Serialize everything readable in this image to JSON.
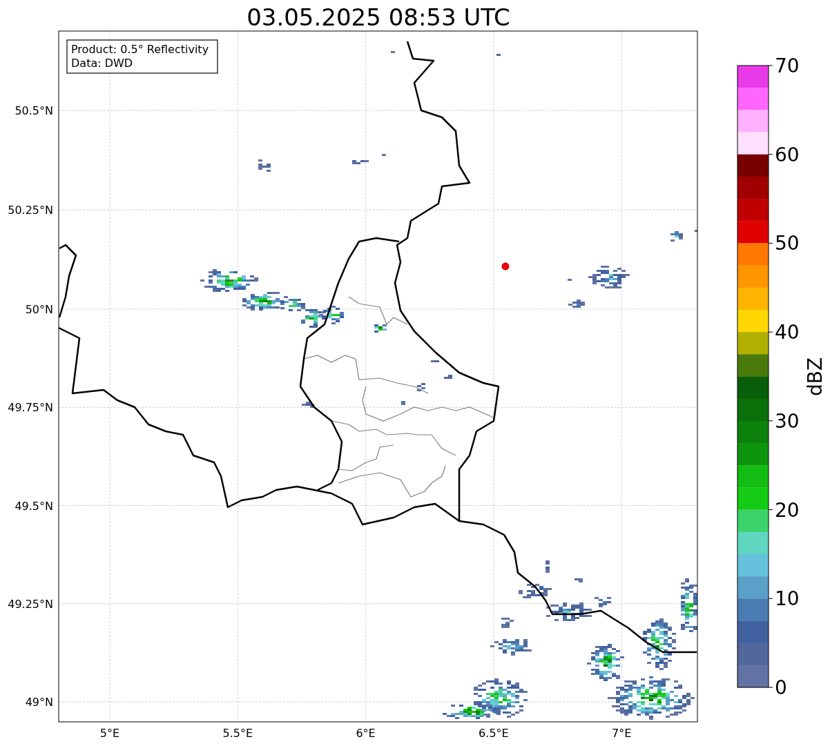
{
  "title": "03.05.2025 08:53 UTC",
  "map": {
    "info_box": [
      "Product: 0.5° Reflectivity",
      "Data: DWD"
    ],
    "lat_ticks": [
      "50.5°N",
      "50.25°N",
      "50°N",
      "49.75°N",
      "49.5°N",
      "49.25°N",
      "49°N"
    ],
    "lon_ticks": [
      "5°E",
      "5.5°E",
      "6°E",
      "6.5°E",
      "7°E"
    ]
  },
  "colorbar": {
    "label": "dBZ",
    "ticks": [
      "70",
      "60",
      "50",
      "40",
      "30",
      "20",
      "10",
      "0"
    ],
    "bins": [
      {
        "color": "#e93ae9"
      },
      {
        "color": "#ff66ff"
      },
      {
        "color": "#ffb0ff"
      },
      {
        "color": "#ffe0ff"
      },
      {
        "color": "#780000"
      },
      {
        "color": "#a00000"
      },
      {
        "color": "#c00000"
      },
      {
        "color": "#e00000"
      },
      {
        "color": "#ff7800"
      },
      {
        "color": "#ff9600"
      },
      {
        "color": "#ffb400"
      },
      {
        "color": "#ffd700"
      },
      {
        "color": "#b0b000"
      },
      {
        "color": "#4a7a0a"
      },
      {
        "color": "#095e09"
      },
      {
        "color": "#0a700a"
      },
      {
        "color": "#0c820c"
      },
      {
        "color": "#0e950e"
      },
      {
        "color": "#12bc12"
      },
      {
        "color": "#14cc14"
      },
      {
        "color": "#3cd46a"
      },
      {
        "color": "#5fd6c0"
      },
      {
        "color": "#66c2dc"
      },
      {
        "color": "#5aa0c8"
      },
      {
        "color": "#4a7cb4"
      },
      {
        "color": "#4060a0"
      },
      {
        "color": "#50689c"
      },
      {
        "color": "#6272a4"
      }
    ]
  }
}
